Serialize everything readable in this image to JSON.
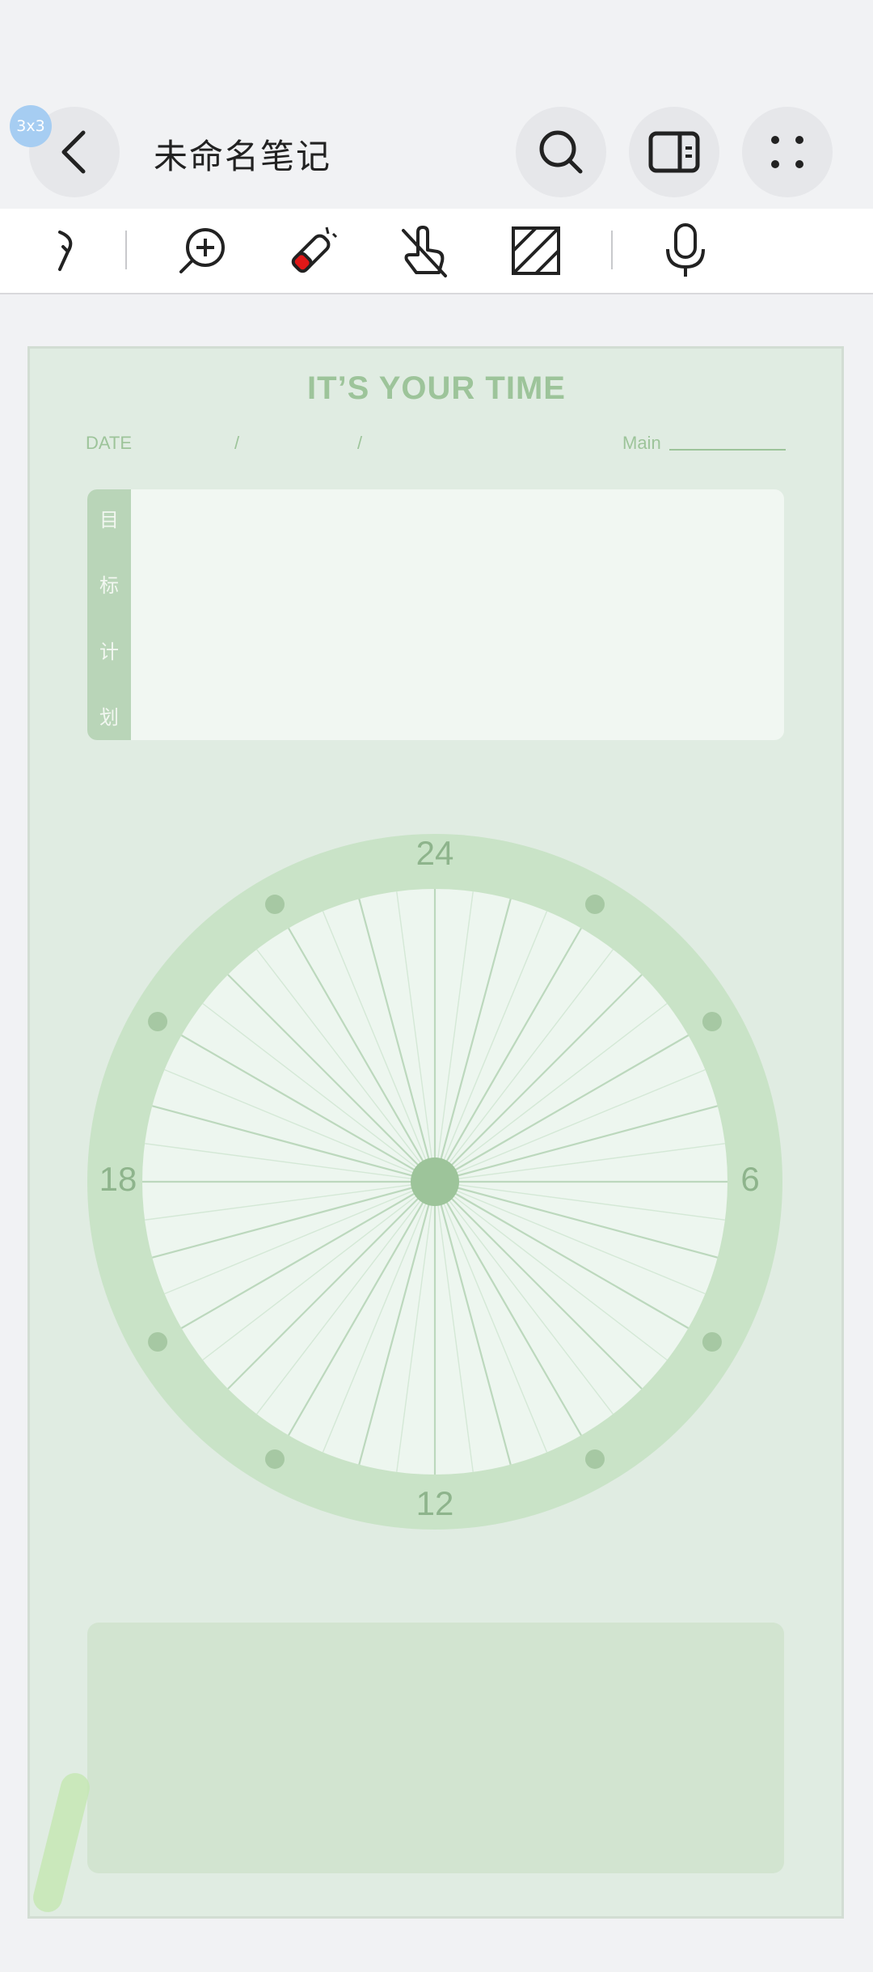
{
  "header": {
    "badge": "3x3",
    "title": "未命名笔记"
  },
  "toolbar": {
    "tools": [
      "redo",
      "zoom-in",
      "eraser",
      "touch-disable",
      "hatch-pattern",
      "microphone"
    ]
  },
  "page": {
    "title": "IT’S YOUR TIME",
    "date_label": "DATE",
    "date_sep1": "/",
    "date_sep2": "/",
    "main_label": "Main",
    "goal_chars": [
      "目",
      "标",
      "计",
      "划"
    ]
  },
  "clock": {
    "top": "24",
    "right": "6",
    "bottom": "12",
    "left": "18",
    "hours": 24
  },
  "colors": {
    "page_bg": "#e0ece2",
    "accent": "#9dc49a",
    "ring": "#c9e3c7",
    "dial": "#edf6ef",
    "side_bar": "#b9d5b8",
    "bottom_box": "#d2e4d0"
  }
}
